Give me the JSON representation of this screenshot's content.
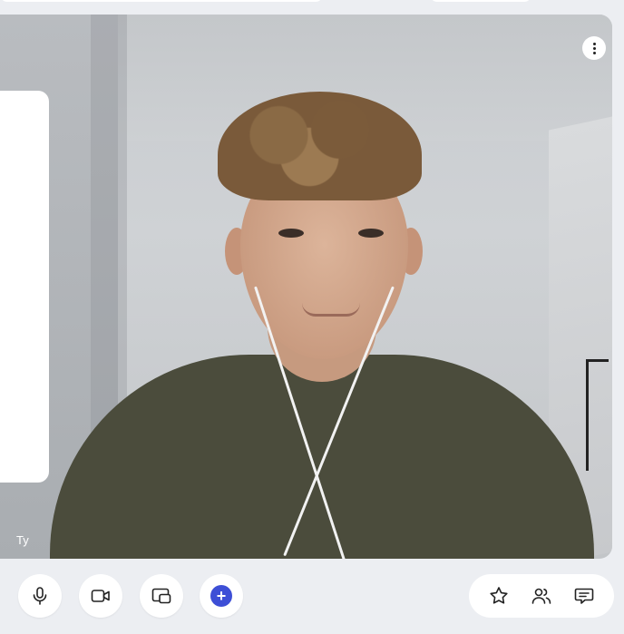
{
  "participant": {
    "name": "Ty"
  },
  "controls": {
    "microphone": "microphone-icon",
    "camera": "video-camera-icon",
    "screen_share": "screen-share-icon",
    "more": "plus-icon",
    "favorite": "star-icon",
    "participants": "people-icon",
    "chat": "chat-icon"
  },
  "colors": {
    "background": "#eceef2",
    "accent": "#3d4fd6",
    "control_bg": "#ffffff"
  }
}
